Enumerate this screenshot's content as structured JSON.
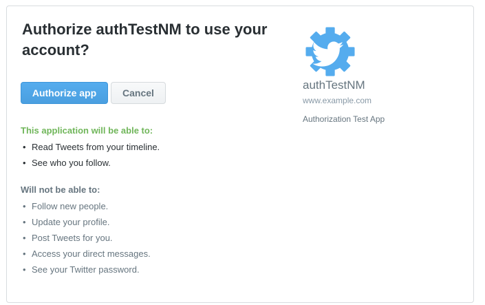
{
  "dialog": {
    "title": "Authorize authTestNM to use your account?",
    "authorize_label": "Authorize app",
    "cancel_label": "Cancel"
  },
  "permissions": {
    "can_heading": "This application will be able to:",
    "can": [
      "Read Tweets from your timeline.",
      "See who you follow."
    ],
    "cannot_heading": "Will not be able to:",
    "cannot": [
      "Follow new people.",
      "Update your profile.",
      "Post Tweets for you.",
      "Access your direct messages.",
      "See your Twitter password."
    ]
  },
  "app": {
    "icon": "twitter-gear-logo-icon",
    "name": "authTestNM",
    "url": "www.example.com",
    "description": "Authorization Test App"
  },
  "colors": {
    "primary": "#55acee",
    "allowed": "#70b65a",
    "muted": "#66757f"
  }
}
